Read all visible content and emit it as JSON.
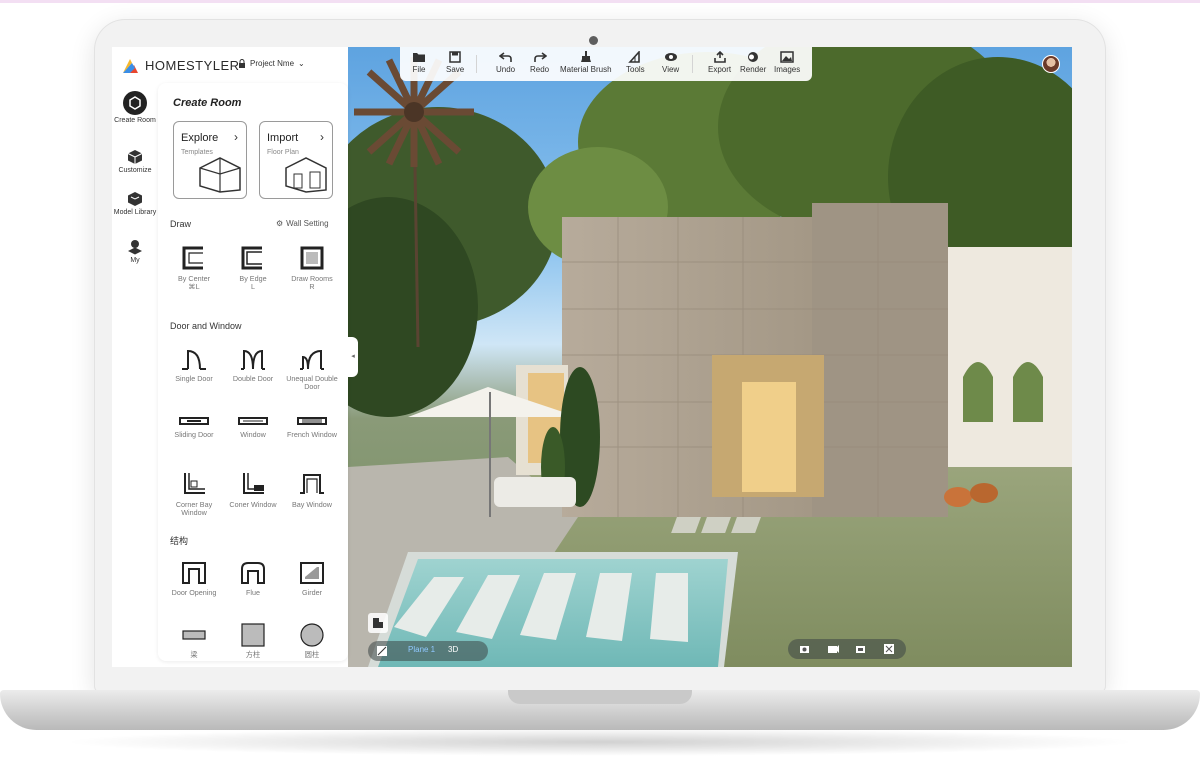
{
  "app": {
    "brand": "HOMESTYLER",
    "project_name": "Project Nme",
    "brand_colors": [
      "#f6b72b",
      "#e8462e",
      "#3a8ee6"
    ]
  },
  "nav": [
    {
      "label": "Create Room",
      "icon": "create-room-icon"
    },
    {
      "label": "Customize",
      "icon": "cube-icon"
    },
    {
      "label": "Model Library",
      "icon": "box-icon"
    },
    {
      "label": "My",
      "icon": "user-cube-icon"
    }
  ],
  "toolbar": [
    {
      "label": "File",
      "icon": "folder-icon"
    },
    {
      "label": "Save",
      "icon": "save-icon"
    },
    {
      "label": "Undo",
      "icon": "undo-icon"
    },
    {
      "label": "Redo",
      "icon": "redo-icon"
    },
    {
      "label": "Material Brush",
      "icon": "brush-icon"
    },
    {
      "label": "Tools",
      "icon": "tools-icon"
    },
    {
      "label": "View",
      "icon": "eye-icon"
    },
    {
      "label": "Export",
      "icon": "export-icon"
    },
    {
      "label": "Render",
      "icon": "render-icon"
    },
    {
      "label": "Images",
      "icon": "images-icon"
    }
  ],
  "panel": {
    "title": "Create Room",
    "explore": {
      "title": "Explore",
      "sub": "Templates"
    },
    "import": {
      "title": "Import",
      "sub": "Floor Plan"
    },
    "draw_title": "Draw",
    "wall_setting": "Wall Setting",
    "draw_tools": [
      {
        "label": "By Center",
        "shortcut": "⌘L"
      },
      {
        "label": "By Edge",
        "shortcut": "L"
      },
      {
        "label": "Draw Rooms",
        "shortcut": "R"
      }
    ],
    "door_window_title": "Door and Window",
    "door_tools": [
      {
        "label": "Single Door"
      },
      {
        "label": "Double Door"
      },
      {
        "label": "Unequal Double Door"
      },
      {
        "label": "Sliding Door"
      },
      {
        "label": "Window"
      },
      {
        "label": "French Window"
      },
      {
        "label": "Corner Bay Window"
      },
      {
        "label": "Coner Window"
      },
      {
        "label": "Bay Window"
      }
    ],
    "structure_title": "结构",
    "structure_tools": [
      {
        "label": "Door Opening"
      },
      {
        "label": "Flue"
      },
      {
        "label": "Girder"
      },
      {
        "label": "梁"
      },
      {
        "label": "方柱"
      },
      {
        "label": "圆柱"
      }
    ]
  },
  "view_modes": {
    "plane": "Plane 1",
    "three_d": "3D",
    "active": "Plane 1"
  }
}
